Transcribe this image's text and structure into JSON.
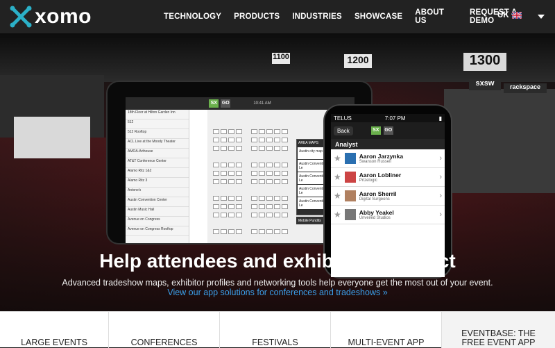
{
  "brand": {
    "name": "xomo",
    "accent": "#2bb0c7"
  },
  "nav": {
    "items": [
      "TECHNOLOGY",
      "PRODUCTS",
      "INDUSTRIES",
      "SHOWCASE",
      "ABOUT US",
      "REQUEST A DEMO"
    ],
    "locale": "UK"
  },
  "hero": {
    "signs": [
      "1100",
      "1200",
      "1300",
      "sxsw",
      "rackspace"
    ],
    "tablet": {
      "time": "10:41 AM",
      "list": [
        "18th Floor at Hilton Garden Inn",
        "512",
        "512 Rooftop",
        "ACL Live at the Moody Theater",
        "AMOA-Arthouse",
        "AT&T Conference Center",
        "Alamo Ritz 1&2",
        "Alamo Ritz 3",
        "Antone's",
        "Austin Convention Center",
        "Austin Music Hall",
        "Avenue on Congress",
        "Avenue on Congress Rooftop"
      ],
      "popover_title": "AREA MAPS",
      "popover": [
        "Austin city map",
        "Austin Convention Centre - Le",
        "Austin Convention Centre - Le",
        "Austin Convention Centre - Le",
        "Austin Convention Centre - Le",
        "AT&T Conference Centre - Le"
      ],
      "badge": "Mobile Pundits"
    },
    "phone": {
      "carrier": "TELUS",
      "time": "7:07 PM",
      "back": "Back",
      "section": "Analyst",
      "people": [
        {
          "name": "Aaron Jarzynka",
          "company": "Swanson Russell"
        },
        {
          "name": "Aaron Lobliner",
          "company": "Prizelogic"
        },
        {
          "name": "Aaron Sherril",
          "company": "Digital Surgeons"
        },
        {
          "name": "Abby Yeakel",
          "company": "Unveiled Studios"
        }
      ]
    },
    "title": "Help attendees and exhibitors connect",
    "subtitle": "Advanced tradeshow maps, exhibitor profiles and networking tools help everyone get the most out of your event.",
    "link": "View our app solutions for conferences and tradeshows »"
  },
  "tabs": [
    "LARGE EVENTS",
    "CONFERENCES",
    "FESTIVALS",
    "MULTI-EVENT APP",
    "EVENTBASE: THE FREE EVENT APP"
  ]
}
